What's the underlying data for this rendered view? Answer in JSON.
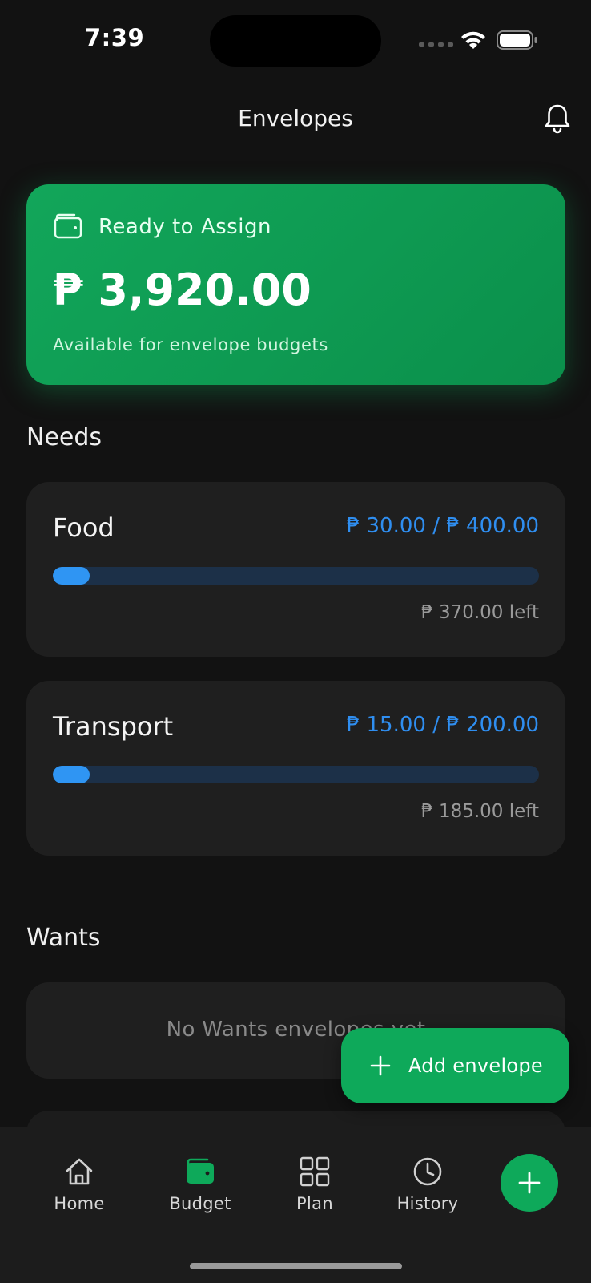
{
  "status_bar": {
    "time": "7:39"
  },
  "header": {
    "title": "Envelopes"
  },
  "ready_card": {
    "label": "Ready to Assign",
    "amount": "₱ 3,920.00",
    "subtitle": "Available for envelope budgets"
  },
  "sections": {
    "needs": {
      "title": "Needs",
      "envelopes": [
        {
          "name": "Food",
          "amounts": "₱ 30.00 / ₱ 400.00",
          "left": "₱ 370.00 left",
          "progress": 0.075
        },
        {
          "name": "Transport",
          "amounts": "₱ 15.00 / ₱ 200.00",
          "left": "₱ 185.00 left",
          "progress": 0.075
        }
      ]
    },
    "wants": {
      "title": "Wants",
      "empty_text": "No Wants envelopes yet"
    }
  },
  "add_button": {
    "label": "Add envelope"
  },
  "bottom_nav": {
    "items": [
      {
        "label": "Home",
        "icon": "house-icon",
        "active": false
      },
      {
        "label": "Budget",
        "icon": "wallet-icon",
        "active": true
      },
      {
        "label": "Plan",
        "icon": "grid-icon",
        "active": false
      },
      {
        "label": "History",
        "icon": "clock-icon",
        "active": false
      }
    ],
    "fab_icon": "plus-icon"
  },
  "colors": {
    "background": "#121212",
    "accent_green": "#0ea95a",
    "progress_blue": "#2f95f3",
    "card": "#1f1f1f"
  }
}
